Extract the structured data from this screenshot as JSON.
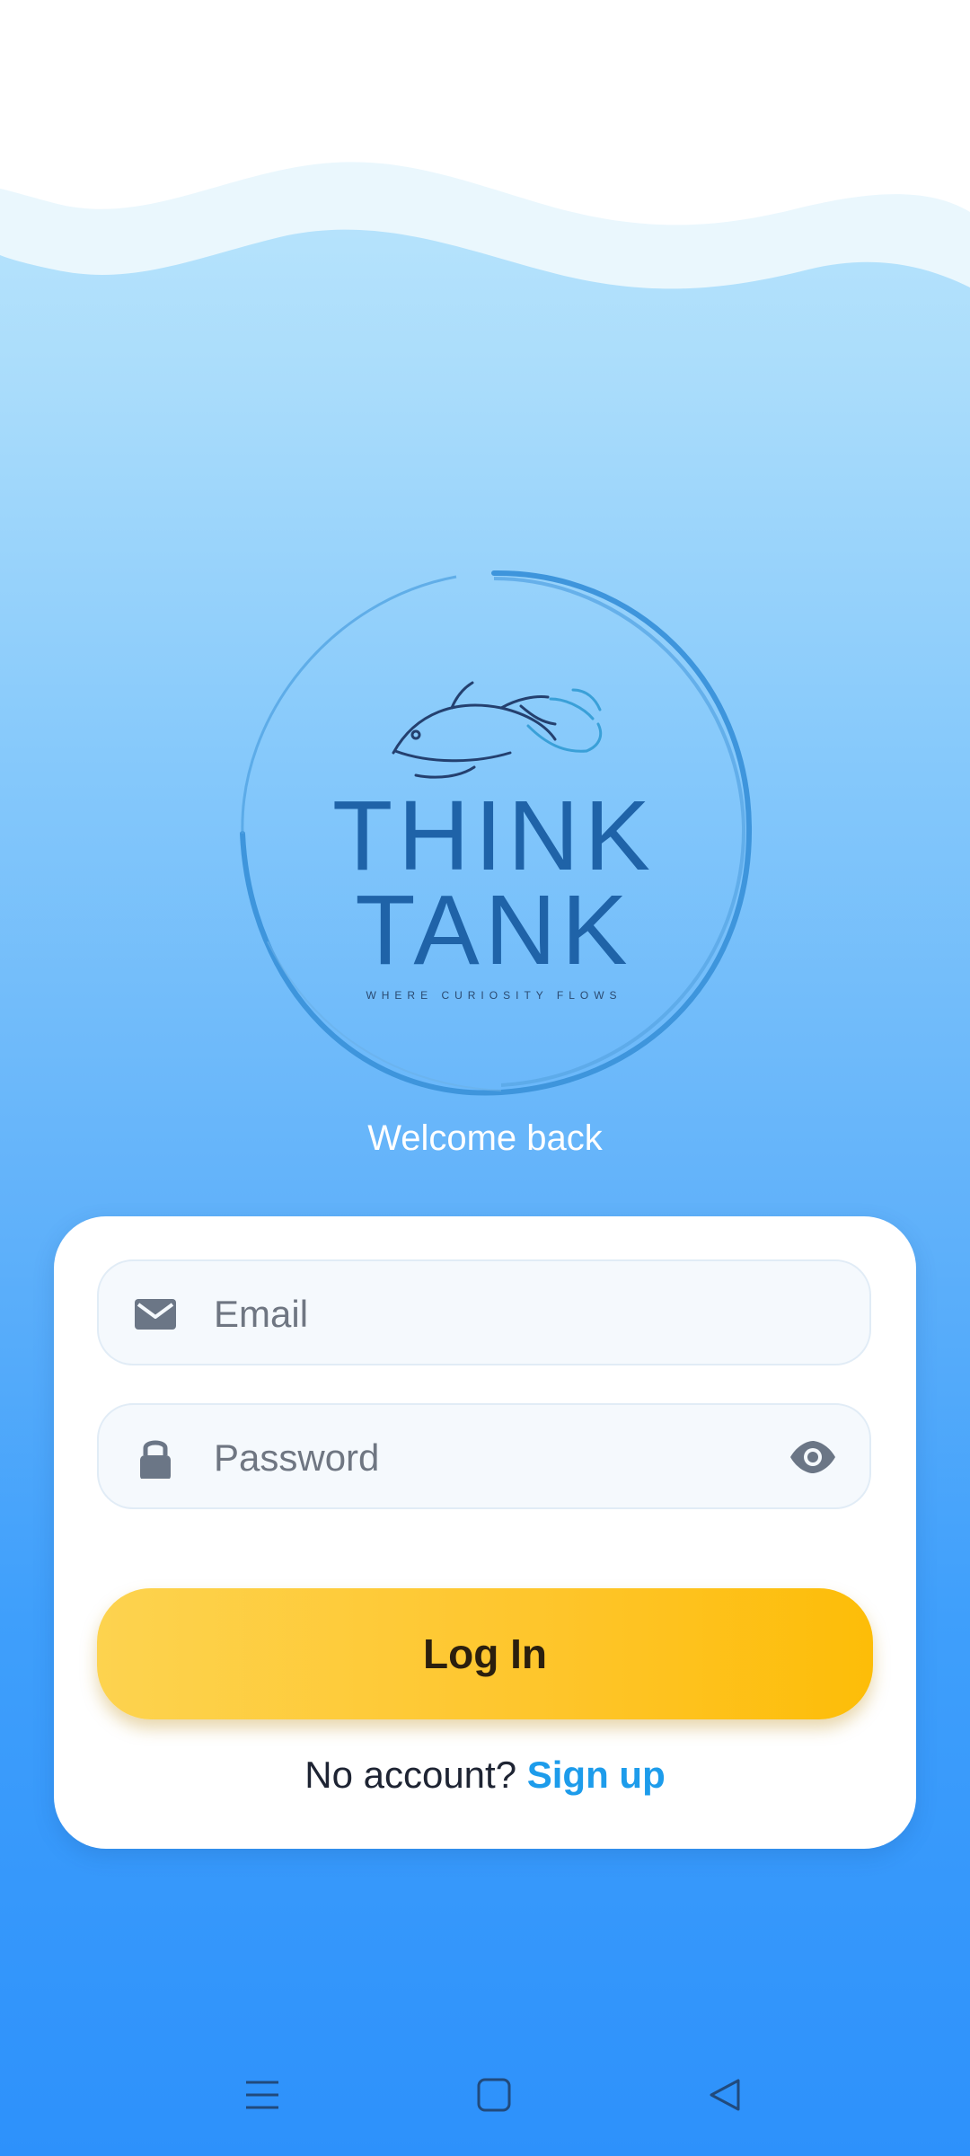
{
  "app": {
    "welcome_text": "Welcome back"
  },
  "logo": {
    "line1": "THINK",
    "line2": "TANK",
    "tagline": "WHERE CURIOSITY FLOWS"
  },
  "form": {
    "email_placeholder": "Email",
    "password_placeholder": "Password",
    "login_label": "Log In",
    "no_account_text": "No account?",
    "signup_label": "Sign up"
  },
  "icons": {
    "email": "mail-icon",
    "password": "lock-icon",
    "toggle_password": "eye-icon"
  },
  "navbar": {
    "items": [
      "menu-icon",
      "home-square-icon",
      "back-triangle-icon"
    ]
  },
  "colors": {
    "accent": "#1d9ceb",
    "button": "#fec52a",
    "logo_blue": "#1f63a8"
  }
}
